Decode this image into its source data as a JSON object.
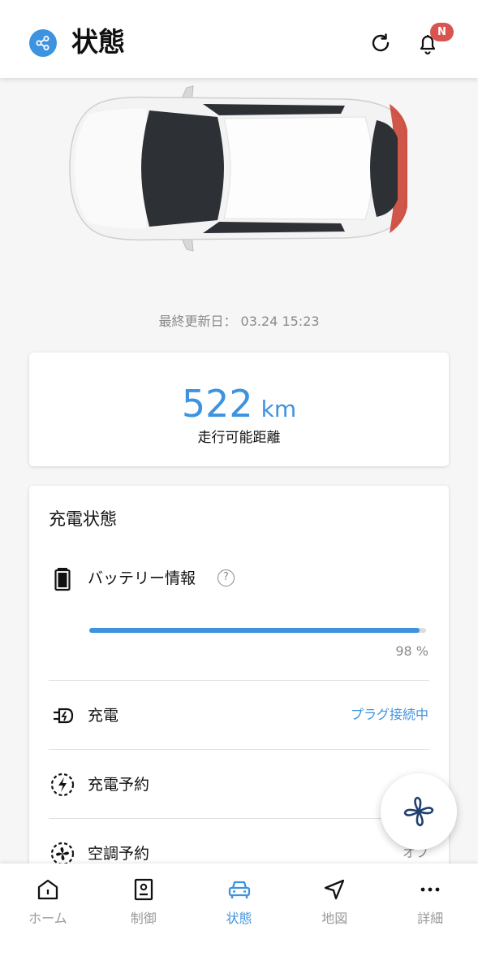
{
  "header": {
    "title": "状態",
    "notification_badge": "N",
    "icons": [
      "share-icon",
      "refresh-icon",
      "bell-icon"
    ]
  },
  "vehicle": {
    "last_updated_label": "最終更新日：",
    "last_updated_value": "03.24 15:23"
  },
  "range": {
    "value": "522",
    "unit": "km",
    "label": "走行可能距離"
  },
  "charge_status": {
    "title": "充電状態",
    "battery": {
      "label": "バッテリー情報",
      "help": "?",
      "level_fraction": 0.98,
      "percent_text": "98 %"
    },
    "rows": [
      {
        "label": "充電",
        "value": "プラグ接続中",
        "icon": "plug-icon"
      },
      {
        "label": "充電予約",
        "value": "",
        "icon": "charge-schedule-icon"
      },
      {
        "label": "空調予約",
        "value": "オフ",
        "icon": "climate-schedule-icon"
      }
    ]
  },
  "fab": {
    "icon": "fan-icon"
  },
  "bottom_nav": {
    "items": [
      {
        "label": "ホーム",
        "icon": "home-icon",
        "active": false
      },
      {
        "label": "制御",
        "icon": "remote-icon",
        "active": false
      },
      {
        "label": "状態",
        "icon": "car-icon",
        "active": true
      },
      {
        "label": "地図",
        "icon": "navigation-icon",
        "active": false
      },
      {
        "label": "詳細",
        "icon": "more-icon",
        "active": false
      }
    ]
  },
  "colors": {
    "accent": "#3d93e0",
    "badge": "#d9534f"
  }
}
